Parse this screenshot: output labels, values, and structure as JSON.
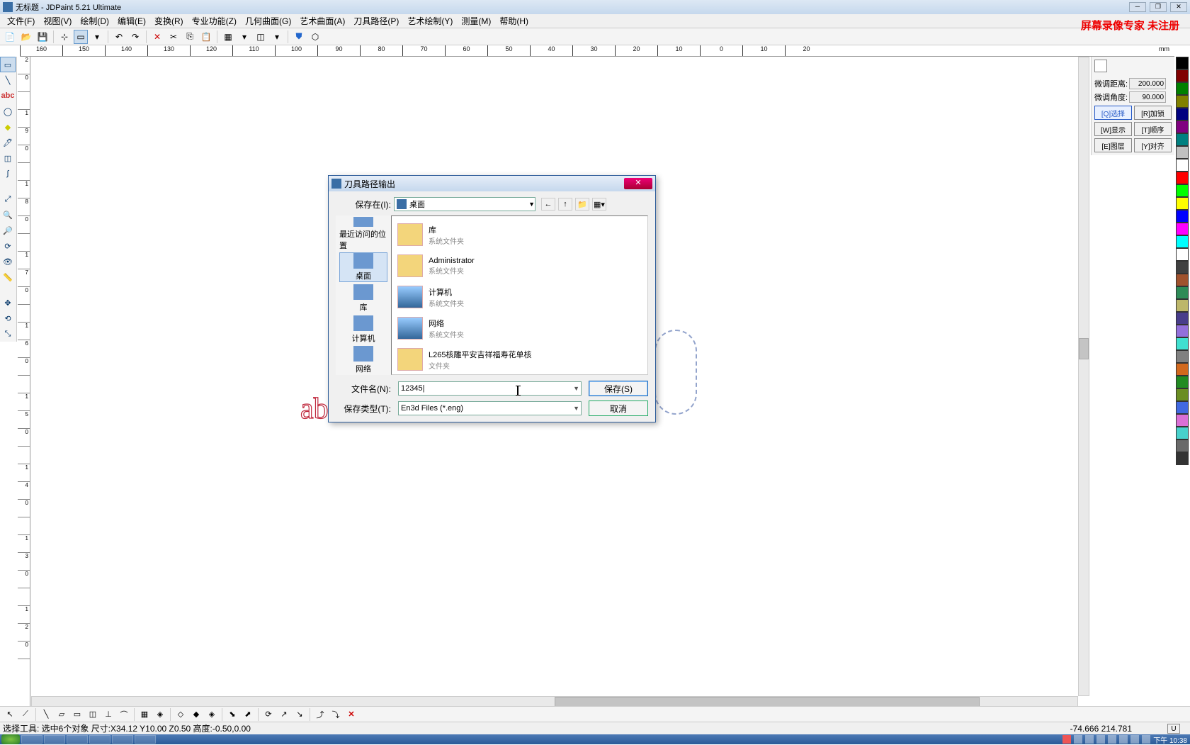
{
  "title": "无标题 - JDPaint 5.21 Ultimate",
  "watermark": "屏幕录像专家 未注册",
  "menu": [
    "文件(F)",
    "视图(V)",
    "绘制(D)",
    "编辑(E)",
    "变换(R)",
    "专业功能(Z)",
    "几何曲面(G)",
    "艺术曲面(A)",
    "刀具路径(P)",
    "艺术绘制(Y)",
    "测量(M)",
    "帮助(H)"
  ],
  "ruler_ticks": [
    "160",
    "150",
    "140",
    "130",
    "120",
    "110",
    "100",
    "90",
    "80",
    "70",
    "60",
    "50",
    "40",
    "30",
    "20",
    "10",
    "0",
    "10",
    "20"
  ],
  "ruler_unit": "mm",
  "vticks": [
    "2",
    "0",
    "",
    "1",
    "9",
    "0",
    "",
    "1",
    "8",
    "0",
    "",
    "1",
    "7",
    "0",
    "",
    "1",
    "6",
    "0",
    "",
    "1",
    "5",
    "0",
    "",
    "1",
    "4",
    "0",
    "",
    "1",
    "3",
    "0",
    "",
    "1",
    "2",
    "0"
  ],
  "canvas_text": "ab",
  "right": {
    "dist_label": "微调距离:",
    "dist_val": "200.000",
    "ang_label": "微调角度:",
    "ang_val": "90.000",
    "btns": [
      "[Q]选择",
      "[R]加锁",
      "[W]显示",
      "[T]顺序",
      "[E]图层",
      "[Y]对齐"
    ]
  },
  "palette": [
    "#000000",
    "#800000",
    "#008000",
    "#808000",
    "#000080",
    "#800080",
    "#008080",
    "#c0c0c0",
    "#ffffff",
    "#ff0000",
    "#00ff00",
    "#ffff00",
    "#0000ff",
    "#ff00ff",
    "#00ffff",
    "#ffffff",
    "#404040",
    "#a0522d",
    "#2e8b57",
    "#bdb76b",
    "#483d8b",
    "#9370db",
    "#40e0d0",
    "#808080",
    "#d2691e",
    "#228b22",
    "#6b8e23",
    "#4169e1",
    "#da70d6",
    "#48d1cc",
    "#696969",
    "#333333"
  ],
  "status": {
    "left": "选择工具: 选中6个对象 尺寸:X34.12 Y10.00 Z0.50 高度:-0.50,0.00",
    "coord": "-74.666 214.781",
    "u": "U"
  },
  "taskbar_time": "下午 10:38",
  "dialog": {
    "title": "刀具路径输出",
    "save_in_label": "保存在(I):",
    "save_in_value": "桌面",
    "places": [
      {
        "label": "最近访问的位置"
      },
      {
        "label": "桌面"
      },
      {
        "label": "库"
      },
      {
        "label": "计算机"
      },
      {
        "label": "网络"
      }
    ],
    "files": [
      {
        "name": "库",
        "sub": "系统文件夹",
        "sys": false
      },
      {
        "name": "Administrator",
        "sub": "系统文件夹",
        "sys": false
      },
      {
        "name": "计算机",
        "sub": "系统文件夹",
        "sys": true
      },
      {
        "name": "网络",
        "sub": "系统文件夹",
        "sys": true
      },
      {
        "name": "L265核雕平安吉祥福寿花单核",
        "sub": "文件夹",
        "sys": false
      }
    ],
    "filename_label": "文件名(N):",
    "filename_value": "12345",
    "filetype_label": "保存类型(T):",
    "filetype_value": "En3d Files (*.eng)",
    "save_btn": "保存(S)",
    "cancel_btn": "取消"
  }
}
